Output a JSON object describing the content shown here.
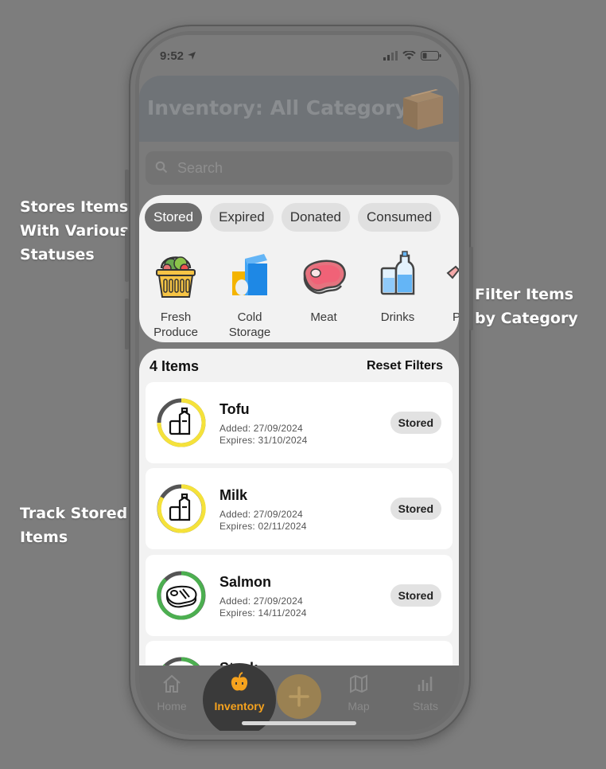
{
  "callouts": {
    "statuses": "Stores Items\nWith Various\nStatuses",
    "filter": "Filter Items\nby Category",
    "track": "Track Stored\nItems"
  },
  "status_bar": {
    "time": "9:52"
  },
  "header": {
    "title": "Inventory: All Category",
    "icon": "box-icon"
  },
  "search": {
    "placeholder": "Search"
  },
  "status_filters": [
    {
      "label": "Stored",
      "active": true
    },
    {
      "label": "Expired",
      "active": false
    },
    {
      "label": "Donated",
      "active": false
    },
    {
      "label": "Consumed",
      "active": false
    }
  ],
  "categories": [
    {
      "label": "Fresh\nProduce",
      "icon": "produce-basket-icon"
    },
    {
      "label": "Cold\nStorage",
      "icon": "milk-carton-icon"
    },
    {
      "label": "Meat",
      "icon": "steak-icon"
    },
    {
      "label": "Drinks",
      "icon": "bottles-icon"
    },
    {
      "label": "P",
      "icon": "partial-category-icon"
    }
  ],
  "items_header": {
    "count": "4 Items",
    "reset": "Reset Filters"
  },
  "items": [
    {
      "name": "Tofu",
      "added": "Added: 27/09/2024",
      "expires": "Expires: 31/10/2024",
      "status": "Stored",
      "ring_color": "#f5e23a",
      "icon": "dairy-icon"
    },
    {
      "name": "Milk",
      "added": "Added: 27/09/2024",
      "expires": "Expires: 02/11/2024",
      "status": "Stored",
      "ring_color": "#f5e23a",
      "icon": "dairy-icon"
    },
    {
      "name": "Salmon",
      "added": "Added: 27/09/2024",
      "expires": "Expires: 14/11/2024",
      "status": "Stored",
      "ring_color": "#4caf50",
      "icon": "meat-icon"
    },
    {
      "name": "Steak",
      "icon": "meat-icon",
      "ring_color": "#4caf50"
    }
  ],
  "tabs": {
    "home": "Home",
    "inventory": "Inventory",
    "map": "Map",
    "stats": "Stats"
  },
  "colors": {
    "accent": "#f5a21e",
    "ring_yellow": "#f5e23a",
    "ring_green": "#4caf50"
  }
}
